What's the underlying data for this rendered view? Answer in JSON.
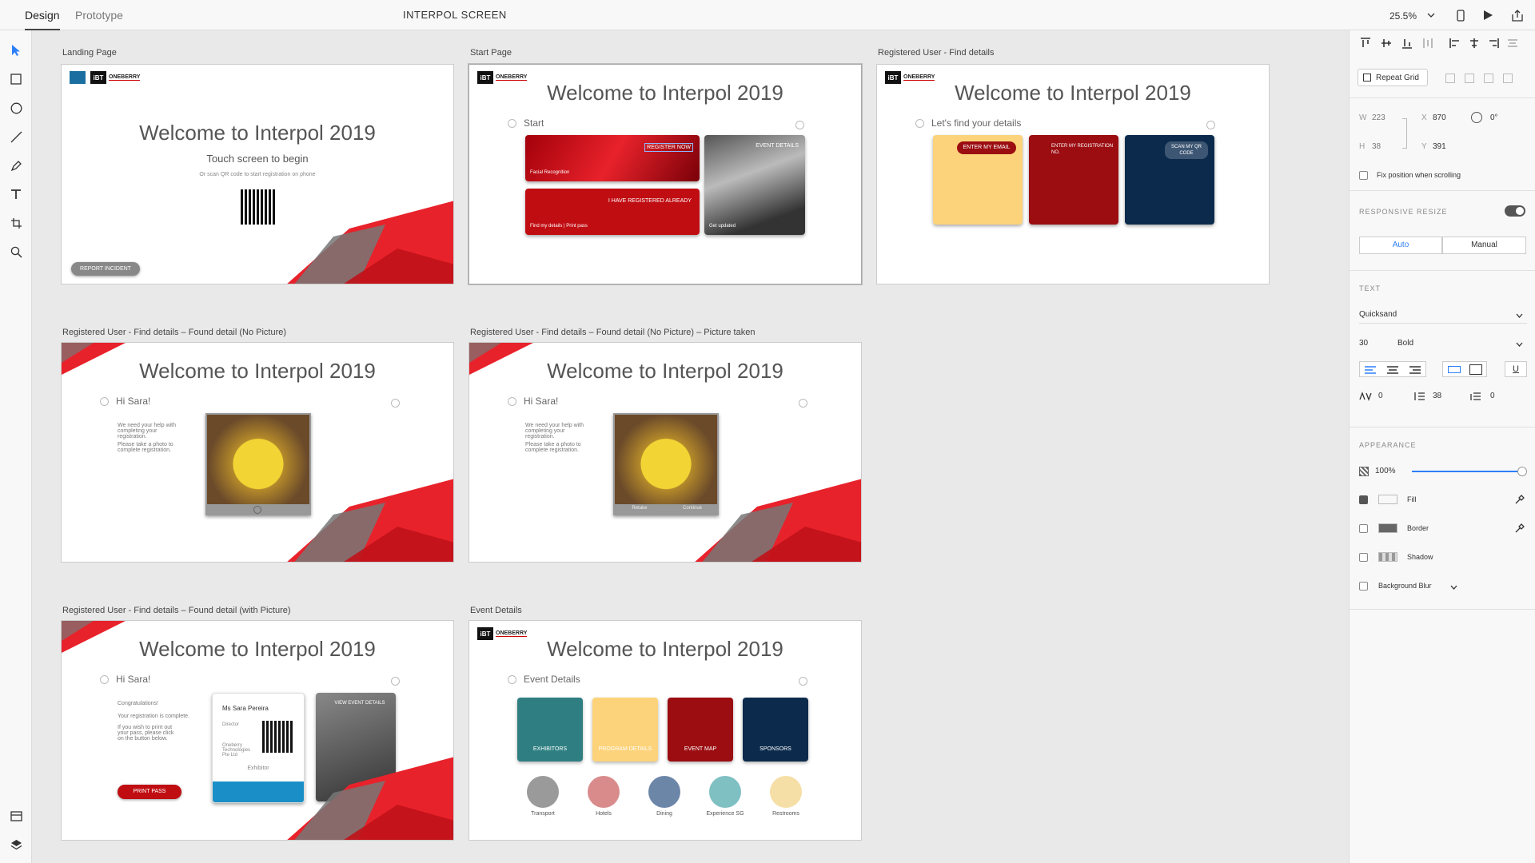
{
  "topbar": {
    "tabs": [
      "Design",
      "Prototype"
    ],
    "document_title": "INTERPOL SCREEN",
    "zoom": "25.5%"
  },
  "toolbar": {
    "tools": [
      "select-icon",
      "rectangle-icon",
      "ellipse-icon",
      "line-icon",
      "pen-icon",
      "text-icon",
      "artboard-icon",
      "zoom-icon"
    ],
    "bottom": [
      "assets-icon",
      "layers-icon"
    ]
  },
  "artboards": {
    "landing": {
      "label": "Landing Page",
      "title": "Welcome to Interpol 2019",
      "subtitle": "Touch screen to begin",
      "hint": "Or scan QR code to start registration on phone",
      "button": "REPORT INCIDENT"
    },
    "start": {
      "label": "Start Page",
      "title": "Welcome to Interpol 2019",
      "section": "Start",
      "register": "REGISTER NOW",
      "register_sub": "Facial Recognition",
      "registered": "I HAVE REGISTERED ALREADY",
      "registered_sub": "Find my details | Print pass",
      "event": "EVENT DETAILS",
      "event_sub": "Get updated"
    },
    "find": {
      "label": "Registered User - Find details",
      "title": "Welcome to Interpol 2019",
      "section": "Let's find your details",
      "email": "ENTER MY EMAIL",
      "regno": "ENTER MY REGISTRATION NO.",
      "qr": "SCAN MY QR CODE"
    },
    "nopic": {
      "label": "Registered User - Find details – Found detail (No Picture)",
      "title": "Welcome to Interpol 2019",
      "greeting": "Hi Sara!",
      "text1": "We need your help with completing your registration.",
      "text2": "Please take a photo to complete registration."
    },
    "taken": {
      "label": "Registered User - Find details – Found detail (No Picture) – Picture taken",
      "title": "Welcome to Interpol 2019",
      "greeting": "Hi Sara!",
      "text1": "We need your help with completing your registration.",
      "text2": "Please take a photo to complete registration.",
      "retake": "Retake",
      "continue": "Continue"
    },
    "withpic": {
      "label": "Registered User - Find details – Found detail (with Picture)",
      "title": "Welcome to Interpol 2019",
      "greeting": "Hi Sara!",
      "congrats": "Congratulations!",
      "complete": "Your registration is complete.",
      "printmsg": "If you wish to print out your pass, please click on the button below.",
      "print": "PRINT PASS",
      "name": "Ms Sara Pereira",
      "role": "Director",
      "company": "Oneberry Technologies Pte Ltd",
      "type": "Exhibitor",
      "view": "VIEW EVENT DETAILS"
    },
    "event": {
      "label": "Event Details",
      "title": "Welcome to Interpol 2019",
      "section": "Event Details",
      "tiles": [
        {
          "label": "EXHIBITORS",
          "color": "#2f7f82"
        },
        {
          "label": "PROGRAM DETAILS",
          "color": "#fcd37a"
        },
        {
          "label": "EVENT MAP",
          "color": "#9b0d11"
        },
        {
          "label": "SPONSORS",
          "color": "#0c2b4c"
        }
      ],
      "circles": [
        {
          "label": "Transport",
          "color": "#9a9a9a"
        },
        {
          "label": "Hotels",
          "color": "#d98b8b"
        },
        {
          "label": "Dining",
          "color": "#6c86a8"
        },
        {
          "label": "Experience SG",
          "color": "#7fc0c3"
        },
        {
          "label": "Restrooms",
          "color": "#f6dfa6"
        }
      ]
    }
  },
  "logo": {
    "mark": "iBT",
    "text": "ONEBERRY"
  },
  "right_panel": {
    "repeat_grid": "Repeat Grid",
    "w_label": "W",
    "w": "223",
    "x_label": "X",
    "x": "870",
    "h_label": "H",
    "h": "38",
    "y_label": "Y",
    "y": "391",
    "rotation": "0°",
    "fix_position": "Fix position when scrolling",
    "responsive": "RESPONSIVE RESIZE",
    "auto": "Auto",
    "manual": "Manual",
    "text_section": "TEXT",
    "font": "Quicksand",
    "font_size": "30",
    "weight": "Bold",
    "char_spacing": "0",
    "line_spacing": "38",
    "para_spacing": "0",
    "appearance": "APPEARANCE",
    "opacity": "100%",
    "opacity_value": 1.0,
    "fill": "Fill",
    "border": "Border",
    "shadow": "Shadow",
    "bg_blur": "Background Blur"
  },
  "colors": {
    "accent": "#2d7ff9",
    "brand_red": "#c00d12",
    "dark_red": "#9b0d11",
    "navy": "#0c2b4c",
    "yellow": "#fcd37a"
  }
}
